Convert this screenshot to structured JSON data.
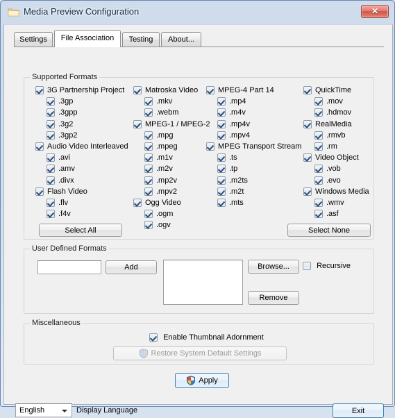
{
  "window": {
    "title": "Media Preview Configuration",
    "icon": "folder-icon",
    "close_label": "✕"
  },
  "tabs": [
    {
      "label": "Settings",
      "selected": false
    },
    {
      "label": "File Association",
      "selected": true
    },
    {
      "label": "Testing",
      "selected": false
    },
    {
      "label": "About...",
      "selected": false
    }
  ],
  "supported_formats": {
    "legend": "Supported Formats",
    "select_all_label": "Select All",
    "select_none_label": "Select None",
    "columns": [
      {
        "items": [
          {
            "label": "3G Partnership Project",
            "checked": true,
            "indent": 0
          },
          {
            "label": ".3gp",
            "checked": true,
            "indent": 1
          },
          {
            "label": ".3gpp",
            "checked": true,
            "indent": 1
          },
          {
            "label": ".3g2",
            "checked": true,
            "indent": 1
          },
          {
            "label": ".3gp2",
            "checked": true,
            "indent": 1
          },
          {
            "label": "Audio Video Interleaved",
            "checked": true,
            "indent": 0
          },
          {
            "label": ".avi",
            "checked": true,
            "indent": 1
          },
          {
            "label": ".amv",
            "checked": true,
            "indent": 1
          },
          {
            "label": ".divx",
            "checked": true,
            "indent": 1
          },
          {
            "label": "Flash Video",
            "checked": true,
            "indent": 0
          },
          {
            "label": ".flv",
            "checked": true,
            "indent": 1
          },
          {
            "label": ".f4v",
            "checked": true,
            "indent": 1
          }
        ]
      },
      {
        "items": [
          {
            "label": "Matroska Video",
            "checked": true,
            "indent": 0
          },
          {
            "label": ".mkv",
            "checked": true,
            "indent": 1
          },
          {
            "label": ".webm",
            "checked": true,
            "indent": 1
          },
          {
            "label": "MPEG-1 / MPEG-2",
            "checked": true,
            "indent": 0
          },
          {
            "label": ".mpg",
            "checked": true,
            "indent": 1
          },
          {
            "label": ".mpeg",
            "checked": true,
            "indent": 1
          },
          {
            "label": ".m1v",
            "checked": true,
            "indent": 1
          },
          {
            "label": ".m2v",
            "checked": true,
            "indent": 1
          },
          {
            "label": ".mp2v",
            "checked": true,
            "indent": 1
          },
          {
            "label": ".mpv2",
            "checked": true,
            "indent": 1
          },
          {
            "label": "Ogg Video",
            "checked": true,
            "indent": 0
          },
          {
            "label": ".ogm",
            "checked": true,
            "indent": 1
          },
          {
            "label": ".ogv",
            "checked": true,
            "indent": 1
          }
        ]
      },
      {
        "items": [
          {
            "label": "MPEG-4 Part 14",
            "checked": true,
            "indent": 0
          },
          {
            "label": ".mp4",
            "checked": true,
            "indent": 1
          },
          {
            "label": ".m4v",
            "checked": true,
            "indent": 1
          },
          {
            "label": ".mp4v",
            "checked": true,
            "indent": 1
          },
          {
            "label": ".mpv4",
            "checked": true,
            "indent": 1
          },
          {
            "label": "MPEG Transport Stream",
            "checked": true,
            "indent": 0
          },
          {
            "label": ".ts",
            "checked": true,
            "indent": 1
          },
          {
            "label": ".tp",
            "checked": true,
            "indent": 1
          },
          {
            "label": ".m2ts",
            "checked": true,
            "indent": 1
          },
          {
            "label": ".m2t",
            "checked": true,
            "indent": 1
          },
          {
            "label": ".mts",
            "checked": true,
            "indent": 1
          }
        ]
      },
      {
        "items": [
          {
            "label": "QuickTime",
            "checked": true,
            "indent": 0
          },
          {
            "label": ".mov",
            "checked": true,
            "indent": 1
          },
          {
            "label": ".hdmov",
            "checked": true,
            "indent": 1
          },
          {
            "label": "RealMedia",
            "checked": true,
            "indent": 0
          },
          {
            "label": ".rmvb",
            "checked": true,
            "indent": 1
          },
          {
            "label": ".rm",
            "checked": true,
            "indent": 1
          },
          {
            "label": "Video Object",
            "checked": true,
            "indent": 0
          },
          {
            "label": ".vob",
            "checked": true,
            "indent": 1
          },
          {
            "label": ".evo",
            "checked": true,
            "indent": 1
          },
          {
            "label": "Windows Media",
            "checked": true,
            "indent": 0
          },
          {
            "label": ".wmv",
            "checked": true,
            "indent": 1
          },
          {
            "label": ".asf",
            "checked": true,
            "indent": 1
          }
        ]
      }
    ]
  },
  "user_defined": {
    "legend": "User Defined Formats",
    "input_value": "",
    "input_placeholder": "",
    "add_label": "Add",
    "browse_label": "Browse...",
    "remove_label": "Remove",
    "recursive_label": "Recursive",
    "recursive_checked": false,
    "list_items": []
  },
  "miscellaneous": {
    "legend": "Miscellaneous",
    "thumbnail_label": "Enable Thumbnail Adornment",
    "thumbnail_checked": true,
    "restore_label": "Restore System Default Settings",
    "restore_enabled": false
  },
  "apply": {
    "label": "Apply"
  },
  "footer": {
    "language_value": "English",
    "language_options": [
      "English"
    ],
    "language_caption": "Display Language",
    "exit_label": "Exit"
  }
}
